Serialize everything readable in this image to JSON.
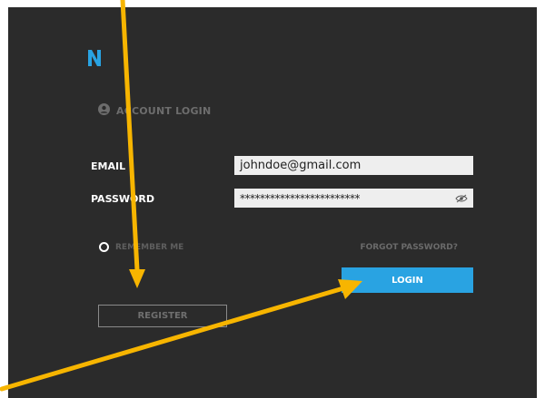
{
  "app": {
    "logo_letter": "N",
    "brand_color": "#29a3e2",
    "background": "#2b2b2b"
  },
  "login": {
    "heading": "ACCOUNT LOGIN",
    "email_label": "EMAIL",
    "email_value": "johndoe@gmail.com",
    "password_label": "PASSWORD",
    "password_value": "************************",
    "remember_label": "REMEMBER ME",
    "forgot_label": "FORGOT PASSWORD?",
    "login_label": "LOGIN",
    "register_label": "REGISTER"
  },
  "annotations": {
    "arrow_color": "#f7b500"
  }
}
